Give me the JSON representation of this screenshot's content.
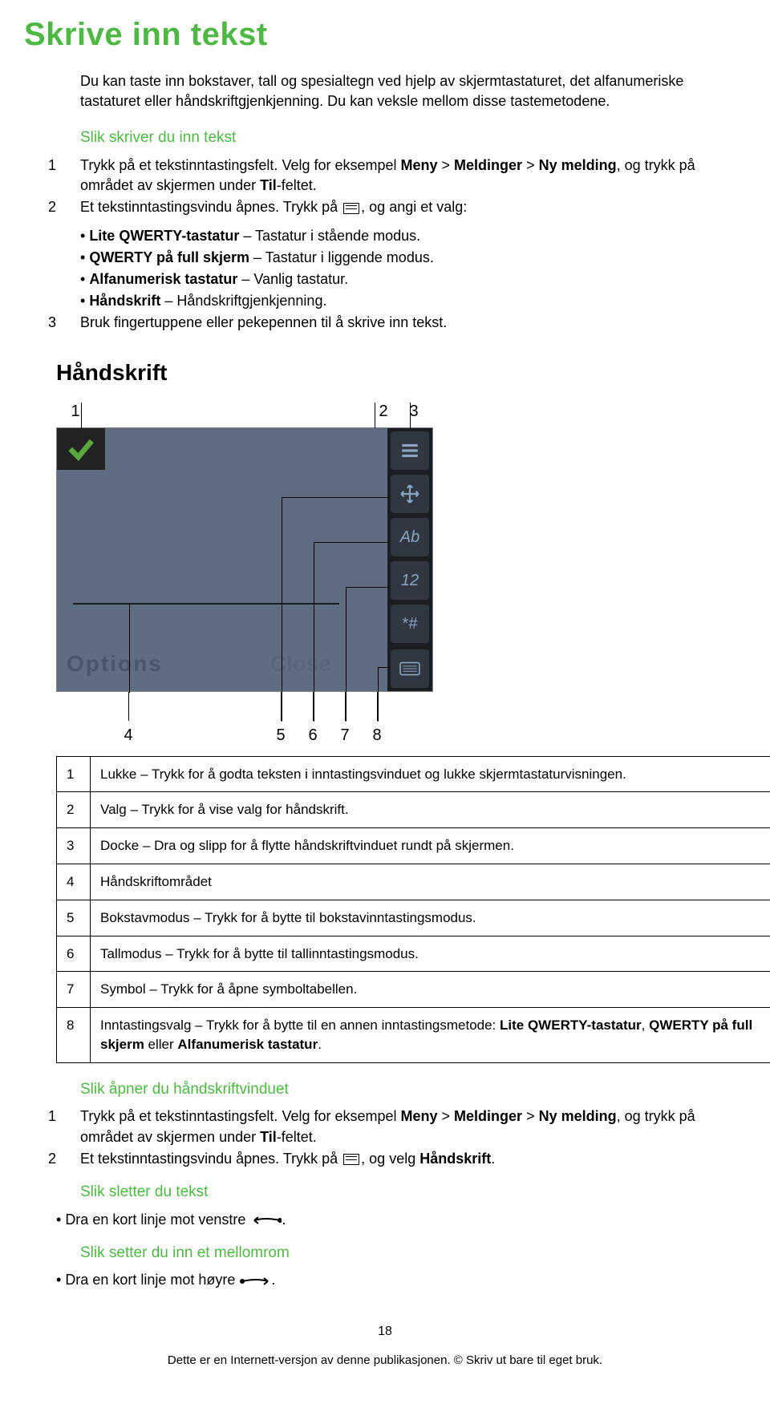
{
  "title": "Skrive inn tekst",
  "intro": "Du kan taste inn bokstaver, tall og spesialtegn ved hjelp av skjermtastaturet, det alfanumeriske tastaturet eller håndskriftgjenkjenning. Du kan veksle mellom disse tastemetodene.",
  "sub1": "Slik skriver du inn tekst",
  "steps1": {
    "n1": "1",
    "c1_a": "Trykk på et tekstinntastingsfelt. Velg for eksempel ",
    "c1_b": "Meny",
    "c1_c": " > ",
    "c1_d": "Meldinger",
    "c1_e": " > ",
    "c1_f": "Ny melding",
    "c1_g": ", og trykk på området av skjermen under ",
    "c1_h": "Til",
    "c1_i": "-feltet.",
    "n2": "2",
    "c2_a": "Et tekstinntastingsvindu åpnes. Trykk på ",
    "c2_b": ", og angi et valg:"
  },
  "bullets1": [
    {
      "b": "Lite QWERTY-tastatur",
      "t": " – Tastatur i stående modus."
    },
    {
      "b": "QWERTY på full skjerm",
      "t": " – Tastatur i liggende modus."
    },
    {
      "b": "Alfanumerisk tastatur",
      "t": " – Vanlig tastatur."
    },
    {
      "b": "Håndskrift",
      "t": " – Håndskriftgjenkjenning."
    }
  ],
  "steps1b": {
    "n3": "3",
    "c3": "Bruk fingertuppene eller pekepennen til å skrive inn tekst."
  },
  "section2": "Håndskrift",
  "callout_top": {
    "a": "1",
    "b": "2",
    "c": "3"
  },
  "scr": {
    "options": "Options",
    "close": "Close",
    "ab": "Ab",
    "one_two": "12",
    "sym": "*#"
  },
  "callout_bot": {
    "a": "4",
    "b": "5",
    "c": "6",
    "d": "7",
    "e": "8"
  },
  "legend": [
    {
      "k": "1",
      "v": "Lukke – Trykk for å godta teksten i inntastingsvinduet og lukke skjermtastaturvisningen."
    },
    {
      "k": "2",
      "v": "Valg – Trykk for å vise valg for håndskrift."
    },
    {
      "k": "3",
      "v": "Docke – Dra og slipp for å flytte håndskriftvinduet rundt på skjermen."
    },
    {
      "k": "4",
      "v": "Håndskriftområdet"
    },
    {
      "k": "5",
      "v": "Bokstavmodus – Trykk for å bytte til bokstavinntastingsmodus."
    },
    {
      "k": "6",
      "v": "Tallmodus – Trykk for å bytte til tallinntastingsmodus."
    },
    {
      "k": "7",
      "v": "Symbol – Trykk for å åpne symboltabellen."
    },
    {
      "k": "8",
      "v_a": "Inntastingsvalg – Trykk for å bytte til en annen inntastingsmetode: ",
      "v_b": "Lite QWERTY-tastatur",
      "v_c": ", ",
      "v_d": "QWERTY på full skjerm",
      "v_e": " eller ",
      "v_f": "Alfanumerisk tastatur",
      "v_g": "."
    }
  ],
  "sub2": "Slik åpner du håndskriftvinduet",
  "steps2": {
    "n1": "1",
    "c1_a": "Trykk på et tekstinntastingsfelt. Velg for eksempel ",
    "c1_b": "Meny",
    "c1_c": " > ",
    "c1_d": "Meldinger",
    "c1_e": " > ",
    "c1_f": "Ny melding",
    "c1_g": ", og trykk på området av skjermen under ",
    "c1_h": "Til",
    "c1_i": "-feltet.",
    "n2": "2",
    "c2_a": "Et tekstinntastingsvindu åpnes. Trykk på ",
    "c2_b": ", og velg ",
    "c2_c": "Håndskrift",
    "c2_d": "."
  },
  "sub3": "Slik sletter du tekst",
  "del": "Dra en kort linje mot venstre ",
  "sub4": "Slik setter du inn et mellomrom",
  "space": "Dra en kort linje mot høyre ",
  "page_number": "18",
  "footer_line": "Dette er en Internett-versjon av denne publikasjonen. © Skriv ut bare til eget bruk."
}
